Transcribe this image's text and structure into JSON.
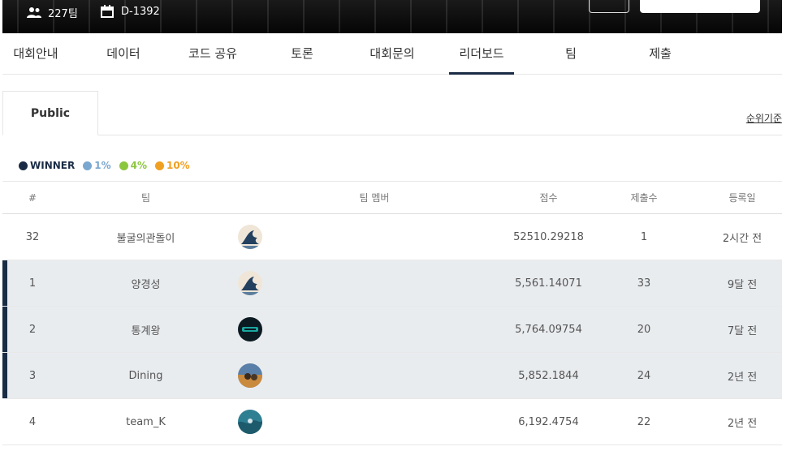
{
  "header": {
    "team_count": "227팀",
    "dday": "D-1392"
  },
  "tabs": [
    {
      "label": "대회안내"
    },
    {
      "label": "데이터"
    },
    {
      "label": "코드 공유"
    },
    {
      "label": "토론"
    },
    {
      "label": "대회문의"
    },
    {
      "label": "리더보드",
      "active": true
    },
    {
      "label": "팀"
    },
    {
      "label": "제출"
    }
  ],
  "subtab": {
    "label": "Public"
  },
  "rank_criteria": "순위기준",
  "legend": [
    {
      "label": "WINNER",
      "color": "#1a2c45"
    },
    {
      "label": "1%",
      "color": "#7aa7cf"
    },
    {
      "label": "4%",
      "color": "#8cc63f"
    },
    {
      "label": "10%",
      "color": "#f0a020"
    }
  ],
  "table": {
    "headers": {
      "rank": "#",
      "team": "팀",
      "members": "팀 멤버",
      "score": "점수",
      "submissions": "제출수",
      "date": "등록일"
    },
    "rows": [
      {
        "rank": "32",
        "team": "불굴의관돌이",
        "avatar": "wave-avatar",
        "score": "52510.29218",
        "submissions": "1",
        "date": "2시간 전",
        "highlight": false
      },
      {
        "rank": "1",
        "team": "양경성",
        "avatar": "wave-avatar",
        "score": "5,561.14071",
        "submissions": "33",
        "date": "9달 전",
        "highlight": true
      },
      {
        "rank": "2",
        "team": "통계왕",
        "avatar": "dark-logo-avatar",
        "score": "5,764.09754",
        "submissions": "20",
        "date": "7달 전",
        "highlight": true
      },
      {
        "rank": "3",
        "team": "Dining",
        "avatar": "sunset-avatar",
        "score": "5,852.1844",
        "submissions": "24",
        "date": "2년 전",
        "highlight": true
      },
      {
        "rank": "4",
        "team": "team_K",
        "avatar": "ocean-avatar",
        "score": "6,192.4754",
        "submissions": "22",
        "date": "2년 전",
        "highlight": false
      }
    ]
  }
}
